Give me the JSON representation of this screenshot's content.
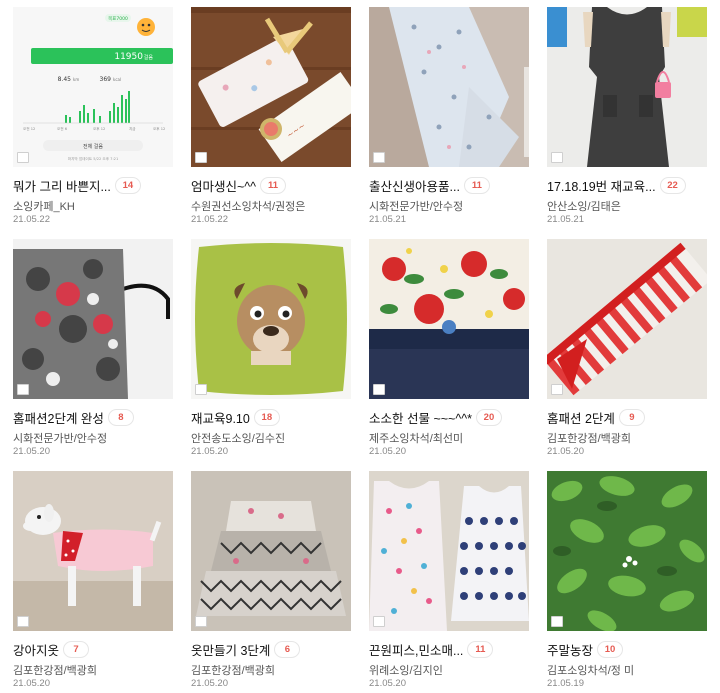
{
  "thumbnail_text": {
    "steps_label": "목표7000",
    "steps_count": "11950",
    "steps_unit": "걸음",
    "distance": "8.45",
    "distance_unit": "km",
    "calories": "369",
    "calories_unit": "kcal",
    "time_labels": [
      "오전 12",
      "오전 6",
      "오후 12",
      "지금",
      "오후 12"
    ],
    "button_label": "전체 걸음",
    "footer": "마지막 업데이트 5/22 오후 7:21"
  },
  "cards": [
    {
      "title": "뭐가 그리 바쁜지...",
      "comments": "14",
      "author": "소잉카페_KH",
      "date": "21.05.22",
      "thumb": "phone-steps-screenshot"
    },
    {
      "title": "엄마생신~^^",
      "comments": "11",
      "author": "수원권선소잉차석/권정은",
      "date": "21.05.22",
      "thumb": "gift-pouch"
    },
    {
      "title": "출산신생아용품...",
      "comments": "11",
      "author": "시화전문가반/안수정",
      "date": "21.05.21",
      "thumb": "baby-cloth"
    },
    {
      "title": "17.18.19번 재교육...",
      "comments": "22",
      "author": "안산소잉/김태은",
      "date": "21.05.21",
      "thumb": "gray-dress"
    },
    {
      "title": "홈패션2단계 완성",
      "comments": "8",
      "author": "시화전문가반/안수정",
      "date": "21.05.20",
      "thumb": "tote-bag"
    },
    {
      "title": "재교육9.10",
      "comments": "18",
      "author": "안전송도소잉/김수진",
      "date": "21.05.20",
      "thumb": "pug-cushion"
    },
    {
      "title": "소소한 선물 ~~~^^*",
      "comments": "20",
      "author": "제주소잉차석/최선미",
      "date": "21.05.20",
      "thumb": "floral-pouch"
    },
    {
      "title": "홈패션 2단계",
      "comments": "9",
      "author": "김포한강점/백광희",
      "date": "21.05.20",
      "thumb": "stripe-runner"
    },
    {
      "title": "강아지옷",
      "comments": "7",
      "author": "김포한강점/백광희",
      "date": "21.05.20",
      "thumb": "dog-clothes"
    },
    {
      "title": "옷만들기 3단계",
      "comments": "6",
      "author": "김포한강점/백광희",
      "date": "21.05.20",
      "thumb": "tiered-skirt"
    },
    {
      "title": "끈원피스,민소매...",
      "comments": "11",
      "author": "위례소잉/김지인",
      "date": "21.05.20",
      "thumb": "kids-dresses"
    },
    {
      "title": "주말농장",
      "comments": "10",
      "author": "김포소잉차석/정 미",
      "date": "21.05.19",
      "thumb": "green-plants"
    }
  ]
}
